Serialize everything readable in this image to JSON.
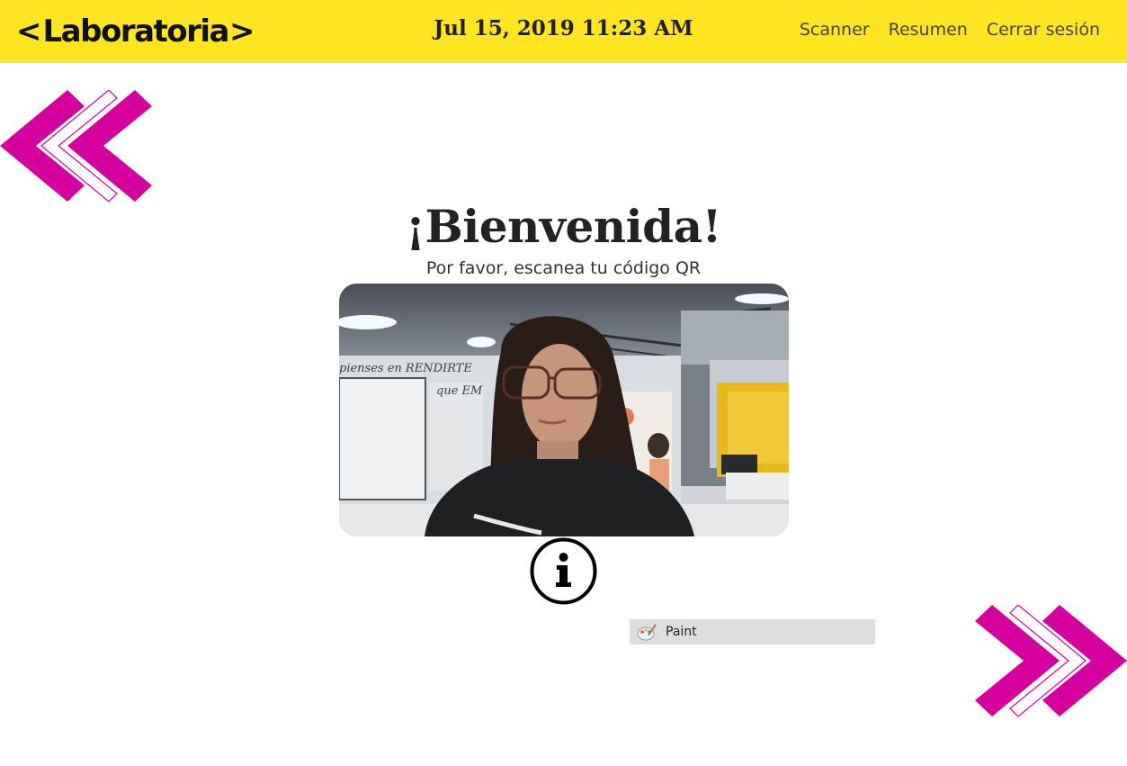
{
  "header": {
    "brand": {
      "left_glyph": "<",
      "name": "Laboratoria",
      "right_glyph": ">"
    },
    "datetime": "Jul 15, 2019 11:23 AM",
    "nav": [
      {
        "label": "Scanner"
      },
      {
        "label": "Resumen"
      },
      {
        "label": "Cerrar sesión"
      }
    ],
    "accent_color": "#FFE521"
  },
  "main": {
    "title": "¡Bienvenida!",
    "subtitle": "Por favor, escanea tu código QR",
    "camera_feed": {
      "icon": "webcam-video-feed",
      "wall_text_1": "pienses en RENDIRTE",
      "wall_text_2": "que EM"
    },
    "info_icon": "info-icon"
  },
  "decorations": {
    "left": "chevrons-left-icon",
    "right": "chevrons-right-icon",
    "color": "#D6009E"
  },
  "taskbar_item": {
    "icon": "paint-icon",
    "label": "Paint"
  }
}
